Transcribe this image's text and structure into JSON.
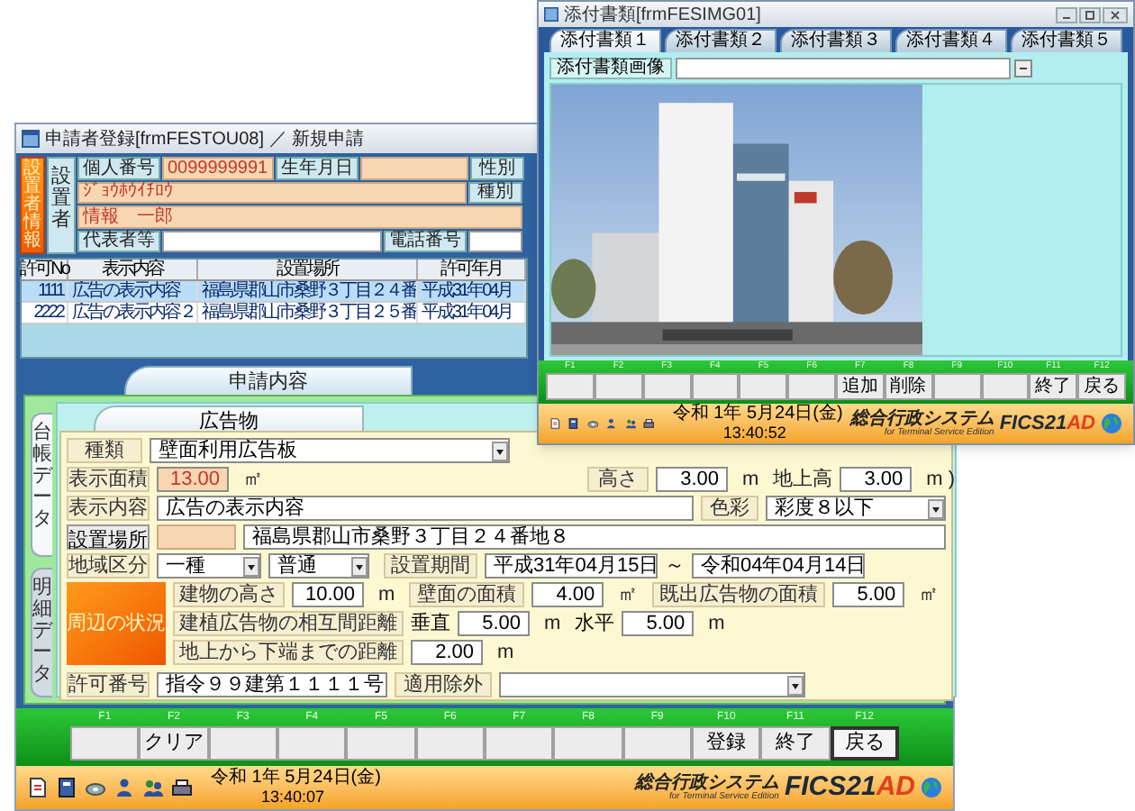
{
  "main_window": {
    "title": "申請者登録[frmFESTOU08] ／ 新規申請",
    "applicant": {
      "section_label": "設置者情報",
      "group_label": "設置者",
      "personal_number": {
        "label": "個人番号",
        "value": "0099999991"
      },
      "birth_date": {
        "label": "生年月日"
      },
      "gender": {
        "label": "性別"
      },
      "kana_name": "ｼﾞｮｳﾎｳｲﾁﾛｳ",
      "category": {
        "label": "種別"
      },
      "name": "情報　一郎",
      "representative": {
        "label": "代表者等"
      },
      "phone": {
        "label": "電話番号"
      }
    },
    "permits": {
      "columns": [
        "許可No",
        "表示内容",
        "設置場所",
        "許可年月"
      ],
      "rows": [
        {
          "cells": [
            "1111",
            "広告の表示内容",
            "福島県郡山市桑野３丁目２４番",
            "平成31年04月"
          ],
          "selected": true
        },
        {
          "cells": [
            "2222",
            "広告の表示内容２",
            "福島県郡山市桑野３丁目２５番",
            "平成31年04月"
          ],
          "selected": false
        }
      ]
    },
    "section_tabs": [
      {
        "label": "申請内容",
        "selected": true
      }
    ],
    "side_tabs": [
      {
        "label": "台帳データ",
        "selected": true
      },
      {
        "label": "明細データ",
        "selected": false
      }
    ],
    "sub_tabs": [
      {
        "label": "広告物",
        "selected": true
      }
    ],
    "form": {
      "type": {
        "label": "種類",
        "value": "壁面利用広告板"
      },
      "display_area": {
        "label": "表示面積",
        "value": "13.00",
        "unit": "㎡"
      },
      "height": {
        "label": "高さ",
        "value": "3.00",
        "unit": "m"
      },
      "ground_height": {
        "label": "地上高",
        "value": "3.00",
        "unit": "m )"
      },
      "content": {
        "label": "表示内容",
        "value": "広告の表示内容"
      },
      "color": {
        "label": "色彩",
        "value": "彩度８以下"
      },
      "location": {
        "button": "設置場所",
        "value": "福島県郡山市桑野３丁目２４番地８"
      },
      "zone": {
        "label": "地域区分",
        "values": [
          "一種",
          "普通"
        ]
      },
      "period": {
        "label": "設置期間",
        "from": "平成31年04月15日",
        "separator": "～",
        "to": "令和04年04月14日"
      },
      "surroundings": {
        "label": "周辺の状況"
      },
      "building_height": {
        "label": "建物の高さ",
        "value": "10.00",
        "unit": "m"
      },
      "wall_area": {
        "label": "壁面の面積",
        "value": "4.00",
        "unit": "㎡"
      },
      "existing_area": {
        "label": "既出広告物の面積",
        "value": "5.00",
        "unit": "㎡"
      },
      "mutual_distance": {
        "label": "建植広告物の相互間距離",
        "vertical_label": "垂直",
        "vertical": "5.00",
        "vertical_unit": "m",
        "horizontal_label": "水平",
        "horizontal": "5.00",
        "horizontal_unit": "m"
      },
      "ground_clearance": {
        "label": "地上から下端までの距離",
        "value": "2.00",
        "unit": "m"
      },
      "permit_number": {
        "label": "許可番号",
        "value": "指令９９建第１１１１号"
      },
      "exemption": {
        "label": "適用除外"
      }
    },
    "function_keys": [
      {
        "key": "F1",
        "focused": false
      },
      {
        "key": "F2",
        "label": "クリア",
        "focused": false
      },
      {
        "key": "F3",
        "focused": false
      },
      {
        "key": "F4",
        "focused": false
      },
      {
        "key": "F5",
        "focused": false
      },
      {
        "key": "F6",
        "focused": false
      },
      {
        "key": "F7",
        "focused": false
      },
      {
        "key": "F8",
        "focused": false
      },
      {
        "key": "F9",
        "focused": false
      },
      {
        "key": "F10",
        "label": "登録",
        "focused": false
      },
      {
        "key": "F11",
        "label": "終了",
        "focused": false
      },
      {
        "key": "F12",
        "label": "戻る",
        "focused": true
      }
    ],
    "status_bar": {
      "date": "令和 1年 5月24日(金)",
      "time": "13:40:07",
      "system_name": "総合行政システム",
      "edition": "for Terminal Service Edition",
      "logo": [
        "FICS21",
        "AD"
      ]
    }
  },
  "attachment_window": {
    "title": "添付書類[frmFESIMG01]",
    "tabs": [
      {
        "label": "添付書類１",
        "selected": true
      },
      {
        "label": "添付書類２",
        "selected": false
      },
      {
        "label": "添付書類３",
        "selected": false
      },
      {
        "label": "添付書類４",
        "selected": false
      },
      {
        "label": "添付書類５",
        "selected": false
      }
    ],
    "image_field": {
      "label": "添付書類画像"
    },
    "function_keys": [
      {
        "key": "F1",
        "focused": false
      },
      {
        "key": "F2",
        "focused": false
      },
      {
        "key": "F3",
        "focused": false
      },
      {
        "key": "F4",
        "focused": false
      },
      {
        "key": "F5",
        "focused": false
      },
      {
        "key": "F6",
        "focused": false
      },
      {
        "key": "F7",
        "label": "追加",
        "focused": false
      },
      {
        "key": "F8",
        "label": "削除",
        "focused": false
      },
      {
        "key": "F9",
        "focused": false
      },
      {
        "key": "F10",
        "focused": false
      },
      {
        "key": "F11",
        "label": "終了",
        "focused": false
      },
      {
        "key": "F12",
        "label": "戻る",
        "focused": false
      }
    ],
    "status_bar": {
      "date": "令和 1年 5月24日(金)",
      "time": "13:40:52",
      "system_name": "総合行政システム",
      "edition": "for Terminal Service Edition",
      "logo": [
        "FICS21",
        "AD"
      ]
    }
  }
}
